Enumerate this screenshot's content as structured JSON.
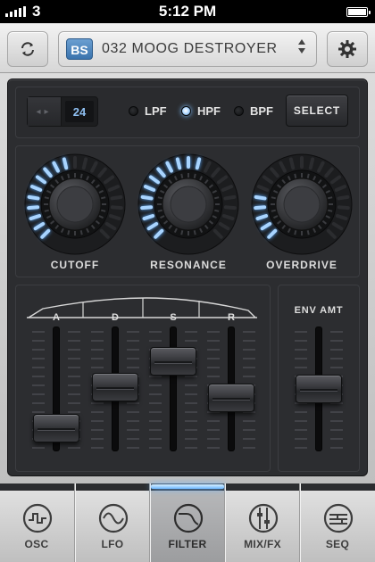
{
  "status": {
    "carrier": "3",
    "time": "5:12 PM",
    "signal_bars": 4,
    "battery_level": 1.0
  },
  "header": {
    "preset_badge": "BS",
    "preset_name": "032 MOOG DESTROYER"
  },
  "filter": {
    "slope_value": "24",
    "types": [
      {
        "label": "LPF",
        "active": false
      },
      {
        "label": "HPF",
        "active": true
      },
      {
        "label": "BPF",
        "active": false
      }
    ],
    "select_label": "SELECT",
    "knobs": [
      {
        "label": "CUTOFF",
        "value": 0.48
      },
      {
        "label": "RESONANCE",
        "value": 0.58
      },
      {
        "label": "OVERDRIVE",
        "value": 0.22
      }
    ],
    "envelope": {
      "labels": [
        "A",
        "D",
        "S",
        "R"
      ],
      "levels": [
        0.18,
        0.55,
        0.78,
        0.45
      ]
    },
    "env_amt": {
      "label": "ENV AMT",
      "level": 0.53
    }
  },
  "tabs": [
    {
      "label": "OSC",
      "icon": "oscillator-wave-icon",
      "active": false
    },
    {
      "label": "LFO",
      "icon": "sine-wave-icon",
      "active": false
    },
    {
      "label": "FILTER",
      "icon": "filter-curve-icon",
      "active": true
    },
    {
      "label": "MIX/FX",
      "icon": "mixer-icon",
      "active": false
    },
    {
      "label": "SEQ",
      "icon": "sequencer-icon",
      "active": false
    }
  ],
  "colors": {
    "accent": "#6cb6ff",
    "panel": "#2c2d30",
    "badge": "#4a86c2"
  }
}
